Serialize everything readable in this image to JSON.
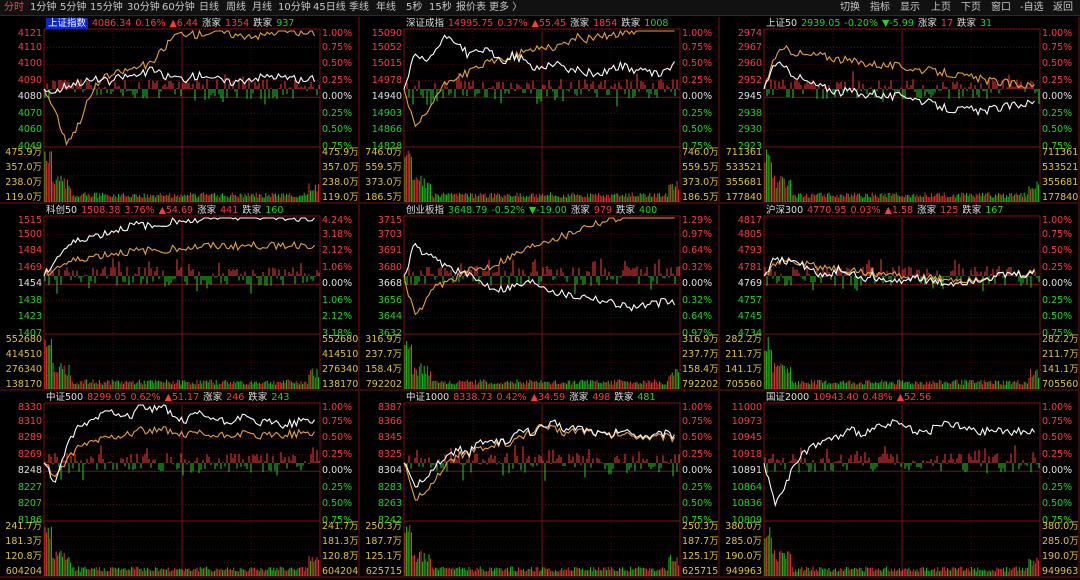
{
  "toolbar": {
    "items": [
      {
        "label": "分时",
        "active": true
      },
      {
        "label": "1分钟"
      },
      {
        "label": "5分钟"
      },
      {
        "label": "15分钟"
      },
      {
        "label": "30分钟"
      },
      {
        "label": "60分钟"
      },
      {
        "label": "日线"
      },
      {
        "label": "周线"
      },
      {
        "label": "月线"
      },
      {
        "label": "10分钟"
      },
      {
        "label": "45日线"
      },
      {
        "label": "季线"
      },
      {
        "label": "年线"
      },
      {
        "label": "5秒"
      },
      {
        "label": "15秒"
      },
      {
        "label": "报价表"
      },
      {
        "label": "更多 〉"
      }
    ],
    "right_items": [
      "切换",
      "指标",
      "显示",
      "上页",
      "下页",
      "窗口",
      "-自选",
      "返回"
    ]
  },
  "colors": {
    "up": "#ff3a3a",
    "down": "#22d422",
    "grid": "#7a1010",
    "price_line": "#ffffff",
    "avg_line": "#e8a040",
    "volume": "#e0c040",
    "selected_tab": "#1226c8"
  },
  "panels": [
    {
      "name": "上证指数",
      "selected": true,
      "price": "4086.34",
      "pct": "0.16%",
      "chg": "▲6.44",
      "adv_label": "涨家",
      "adv": "1354",
      "dec_label": "跌家",
      "dec": "937",
      "left_labels": [
        "4121",
        "4110",
        "4100",
        "4090",
        "4080",
        "4070",
        "4060",
        "4049"
      ],
      "right_labels": [
        "1.00%",
        "0.75%",
        "0.50%",
        "0.25%",
        "0.00%",
        "0.25%",
        "0.50%",
        "0.75%"
      ],
      "vol_left": [
        "475.9万",
        "357.0万",
        "238.0万",
        "119.0万"
      ],
      "vol_right": [
        "475.9万",
        "357.0万",
        "238.0万",
        "119.0万"
      ],
      "price_series": [
        0.0,
        -0.05,
        0.05,
        0.1,
        0.12,
        0.15,
        0.1,
        0.18,
        0.2,
        0.22,
        0.3,
        0.2,
        0.18,
        0.15,
        0.2,
        0.22,
        0.15,
        0.1,
        0.12,
        0.16,
        0.18,
        0.2,
        0.18,
        0.15,
        0.12,
        0.16
      ],
      "avg_series": [
        0.0,
        -0.3,
        -0.8,
        -0.6,
        -0.2,
        0.1,
        0.2,
        0.25,
        0.3,
        0.35,
        0.38,
        0.6,
        0.8,
        0.85,
        0.82,
        0.85,
        0.88,
        0.85,
        0.8,
        0.82,
        0.8,
        0.85,
        0.88,
        0.86,
        0.84,
        0.85
      ],
      "pct_range": 1.0
    },
    {
      "name": "深证成指",
      "selected": false,
      "price": "14995.75",
      "pct": "0.37%",
      "chg": "▲55.45",
      "adv_label": "涨家",
      "adv": "1854",
      "dec_label": "跌家",
      "dec": "1008",
      "left_labels": [
        "15090",
        "15052",
        "15015",
        "14978",
        "14940",
        "14903",
        "14866",
        "14828"
      ],
      "right_labels": [
        "1.00%",
        "0.75%",
        "0.50%",
        "0.25%",
        "0.00%",
        "0.25%",
        "0.50%",
        "0.75%"
      ],
      "vol_left": [
        "746.0万",
        "559.5万",
        "373.0万",
        "186.5万"
      ],
      "vol_right": [
        "746.0万",
        "559.5万",
        "373.0万",
        "186.5万"
      ],
      "price_series": [
        0.0,
        0.5,
        0.4,
        0.6,
        0.8,
        0.7,
        0.5,
        0.6,
        0.55,
        0.4,
        0.5,
        0.45,
        0.3,
        0.35,
        0.4,
        0.3,
        0.28,
        0.25,
        0.22,
        0.3,
        0.35,
        0.3,
        0.28,
        0.22,
        0.25,
        0.37
      ],
      "avg_series": [
        0.0,
        -0.6,
        -0.4,
        -0.1,
        0.1,
        0.2,
        0.25,
        0.35,
        0.4,
        0.45,
        0.5,
        0.55,
        0.6,
        0.65,
        0.62,
        0.7,
        0.78,
        0.75,
        0.82,
        0.8,
        0.85,
        0.88,
        0.9,
        0.92,
        0.95,
        0.9
      ],
      "pct_range": 1.0
    },
    {
      "name": "上证50",
      "selected": false,
      "price": "2939.05",
      "pct": "-0.20%",
      "chg": "▼-5.99",
      "adv_label": "涨家",
      "adv": "17",
      "dec_label": "跌家",
      "dec": "31",
      "left_labels": [
        "2974",
        "2967",
        "2960",
        "2952",
        "2945",
        "2938",
        "2930",
        "2923"
      ],
      "right_labels": [
        "1.00%",
        "0.75%",
        "0.50%",
        "0.25%",
        "0.00%",
        "0.25%",
        "0.50%",
        "0.75%"
      ],
      "vol_left": [
        "711361",
        "533521",
        "355681",
        "177840"
      ],
      "vol_right": [
        "711361",
        "533521",
        "355681",
        "177840"
      ],
      "price_series": [
        0.0,
        0.4,
        0.3,
        0.2,
        0.1,
        0.05,
        0.0,
        -0.05,
        -0.02,
        -0.1,
        -0.05,
        -0.1,
        -0.12,
        -0.08,
        -0.15,
        -0.2,
        -0.25,
        -0.3,
        -0.32,
        -0.3,
        -0.35,
        -0.3,
        -0.28,
        -0.25,
        -0.22,
        -0.2
      ],
      "avg_series": [
        0.0,
        0.5,
        0.6,
        0.55,
        0.5,
        0.52,
        0.48,
        0.45,
        0.42,
        0.4,
        0.38,
        0.36,
        0.35,
        0.33,
        0.3,
        0.28,
        0.26,
        0.24,
        0.2,
        0.18,
        0.15,
        0.12,
        0.1,
        0.08,
        0.06,
        0.05
      ],
      "pct_range": 1.0
    },
    {
      "name": "科创50",
      "selected": false,
      "price": "1508.38",
      "pct": "3.76%",
      "chg": "▲54.69",
      "adv_label": "涨家",
      "adv": "441",
      "dec_label": "跌家",
      "dec": "160",
      "left_labels": [
        "1515",
        "1500",
        "1484",
        "1469",
        "1454",
        "1438",
        "1423",
        "1407"
      ],
      "right_labels": [
        "4.24%",
        "3.18%",
        "2.12%",
        "1.06%",
        "0.00%",
        "1.06%",
        "2.12%",
        "3.18%"
      ],
      "vol_left": [
        "552680",
        "414510",
        "276340",
        "138170"
      ],
      "vol_right": [
        "552680",
        "414510",
        "276340",
        "138170"
      ],
      "price_series": [
        0.0,
        1.0,
        1.8,
        2.2,
        2.5,
        2.6,
        2.8,
        3.0,
        3.2,
        3.3,
        3.1,
        3.4,
        3.5,
        3.6,
        3.5,
        3.7,
        3.8,
        3.9,
        3.8,
        3.9,
        3.85,
        3.9,
        3.8,
        3.7,
        3.75,
        3.76
      ],
      "avg_series": [
        0.0,
        0.5,
        0.8,
        1.0,
        1.2,
        1.3,
        1.4,
        1.5,
        1.55,
        1.6,
        1.65,
        1.7,
        1.75,
        1.8,
        1.85,
        1.9,
        1.9,
        1.92,
        1.9,
        1.93,
        1.95,
        1.96,
        1.97,
        1.98,
        1.99,
        2.0
      ],
      "pct_range": 4.24
    },
    {
      "name": "创业板指",
      "selected": false,
      "price": "3648.79",
      "pct": "-0.52%",
      "chg": "▼-19.00",
      "adv_label": "涨家",
      "adv": "979",
      "dec_label": "跌家",
      "dec": "400",
      "left_labels": [
        "3715",
        "3703",
        "3691",
        "3680",
        "3668",
        "3656",
        "3644",
        "3632"
      ],
      "right_labels": [
        "1.29%",
        "0.97%",
        "0.64%",
        "0.32%",
        "0.00%",
        "0.32%",
        "0.64%",
        "0.97%"
      ],
      "vol_left": [
        "316.9万",
        "237.7万",
        "158.4万",
        "792202"
      ],
      "vol_right": [
        "316.9万",
        "237.7万",
        "158.4万",
        "792202"
      ],
      "price_series": [
        0.0,
        0.6,
        0.4,
        0.3,
        0.2,
        0.1,
        0.0,
        -0.1,
        -0.2,
        -0.25,
        -0.2,
        -0.15,
        -0.1,
        -0.2,
        -0.3,
        -0.35,
        -0.4,
        -0.38,
        -0.45,
        -0.5,
        -0.55,
        -0.6,
        -0.58,
        -0.55,
        -0.5,
        -0.52
      ],
      "avg_series": [
        0.0,
        -0.8,
        -0.5,
        -0.2,
        -0.1,
        0.0,
        0.1,
        0.15,
        0.2,
        0.3,
        0.4,
        0.5,
        0.6,
        0.7,
        0.75,
        0.8,
        0.9,
        1.0,
        1.05,
        1.1,
        1.15,
        1.2,
        1.22,
        1.25,
        1.26,
        1.27
      ],
      "pct_range": 1.29
    },
    {
      "name": "沪深300",
      "selected": false,
      "price": "4770.95",
      "pct": "0.03%",
      "chg": "▲1.58",
      "adv_label": "涨家",
      "adv": "125",
      "dec_label": "跌家",
      "dec": "167",
      "left_labels": [
        "4817",
        "4805",
        "4793",
        "4781",
        "4769",
        "4757",
        "4745",
        "4734"
      ],
      "right_labels": [
        "1.00%",
        "0.75%",
        "0.50%",
        "0.25%",
        "0.00%",
        "0.25%",
        "0.50%",
        "0.75%"
      ],
      "vol_left": [
        "282.2万",
        "211.7万",
        "141.1万",
        "705560"
      ],
      "vol_right": [
        "282.2万",
        "211.7万",
        "141.1万",
        "705560"
      ],
      "price_series": [
        0.0,
        0.3,
        0.2,
        0.25,
        0.1,
        0.05,
        0.0,
        0.1,
        0.05,
        -0.05,
        0.0,
        -0.05,
        -0.1,
        -0.05,
        0.0,
        -0.08,
        -0.1,
        -0.12,
        -0.1,
        -0.08,
        -0.05,
        -0.02,
        0.0,
        0.02,
        0.01,
        0.03
      ],
      "avg_series": [
        0.0,
        0.2,
        0.25,
        0.2,
        0.18,
        0.15,
        0.12,
        0.1,
        0.08,
        0.06,
        0.05,
        0.04,
        0.02,
        0.0,
        -0.02,
        -0.03,
        -0.05,
        -0.04,
        -0.06,
        -0.05,
        -0.03,
        -0.02,
        0.0,
        0.02,
        0.03,
        0.05
      ],
      "pct_range": 1.0
    },
    {
      "name": "中证500",
      "selected": false,
      "price": "8299.05",
      "pct": "0.62%",
      "chg": "▲51.17",
      "adv_label": "涨家",
      "adv": "246",
      "dec_label": "跌家",
      "dec": "243",
      "left_labels": [
        "8330",
        "8310",
        "8289",
        "8269",
        "8248",
        "8227",
        "8207",
        "8186"
      ],
      "right_labels": [
        "1.00%",
        "0.75%",
        "0.50%",
        "0.25%",
        "0.00%",
        "0.25%",
        "0.50%",
        "0.75%"
      ],
      "vol_left": [
        "241.7万",
        "181.3万",
        "120.8万",
        "604204"
      ],
      "vol_right": [
        "241.7万",
        "181.3万",
        "120.8万",
        "604204"
      ],
      "price_series": [
        0.0,
        -0.3,
        0.2,
        0.5,
        0.6,
        0.7,
        0.8,
        0.75,
        0.7,
        0.9,
        0.8,
        0.85,
        0.7,
        0.6,
        0.75,
        0.7,
        0.65,
        0.6,
        0.7,
        0.65,
        0.6,
        0.62,
        0.58,
        0.6,
        0.65,
        0.62
      ],
      "avg_series": [
        0.0,
        -0.2,
        0.0,
        0.2,
        0.3,
        0.35,
        0.4,
        0.42,
        0.45,
        0.5,
        0.48,
        0.5,
        0.45,
        0.4,
        0.45,
        0.42,
        0.4,
        0.42,
        0.44,
        0.42,
        0.4,
        0.42,
        0.43,
        0.44,
        0.45,
        0.44
      ],
      "pct_range": 1.0
    },
    {
      "name": "中证1000",
      "selected": false,
      "price": "8338.73",
      "pct": "0.42%",
      "chg": "▲34.59",
      "adv_label": "涨家",
      "adv": "498",
      "dec_label": "跌家",
      "dec": "481",
      "left_labels": [
        "8387",
        "8366",
        "8345",
        "8325",
        "8304",
        "8283",
        "8263",
        "8242"
      ],
      "right_labels": [
        "1.00%",
        "0.75%",
        "0.50%",
        "0.25%",
        "0.00%",
        "0.25%",
        "0.50%",
        "0.75%"
      ],
      "vol_left": [
        "250.3万",
        "187.7万",
        "125.1万",
        "625715"
      ],
      "vol_right": [
        "250.3万",
        "187.7万",
        "125.1万",
        "625715"
      ],
      "price_series": [
        0.0,
        -0.4,
        -0.2,
        0.0,
        0.1,
        0.2,
        0.15,
        0.3,
        0.35,
        0.3,
        0.4,
        0.5,
        0.45,
        0.55,
        0.6,
        0.5,
        0.55,
        0.5,
        0.45,
        0.4,
        0.5,
        0.45,
        0.42,
        0.4,
        0.45,
        0.42
      ],
      "avg_series": [
        0.0,
        -0.6,
        -0.4,
        -0.2,
        0.0,
        0.1,
        0.15,
        0.2,
        0.25,
        0.3,
        0.32,
        0.4,
        0.5,
        0.55,
        0.5,
        0.45,
        0.5,
        0.48,
        0.45,
        0.42,
        0.44,
        0.42,
        0.4,
        0.38,
        0.4,
        0.38
      ],
      "pct_range": 1.0
    },
    {
      "name": "国证2000",
      "selected": false,
      "price": "10943.40",
      "pct": "0.48%",
      "chg": "▲52.56",
      "adv_label": "",
      "adv": "",
      "dec_label": "",
      "dec": "",
      "left_labels": [
        "11000",
        "10973",
        "10945",
        "10918",
        "10891",
        "10864",
        "10836",
        "10809"
      ],
      "right_labels": [
        "1.00%",
        "0.75%",
        "0.50%",
        "0.25%",
        "0.00%",
        "0.25%",
        "0.50%",
        "0.75%"
      ],
      "vol_left": [
        "380.0万",
        "285.0万",
        "190.0万",
        "949963"
      ],
      "vol_right": [
        "380.0万",
        "285.0万",
        "190.0万",
        "949963"
      ],
      "price_series": [
        0.0,
        -0.6,
        -0.3,
        0.0,
        0.2,
        0.3,
        0.35,
        0.4,
        0.5,
        0.45,
        0.5,
        0.55,
        0.6,
        0.55,
        0.5,
        0.45,
        0.55,
        0.6,
        0.55,
        0.5,
        0.45,
        0.5,
        0.48,
        0.46,
        0.5,
        0.48
      ],
      "avg_series": [],
      "pct_range": 1.0
    }
  ]
}
